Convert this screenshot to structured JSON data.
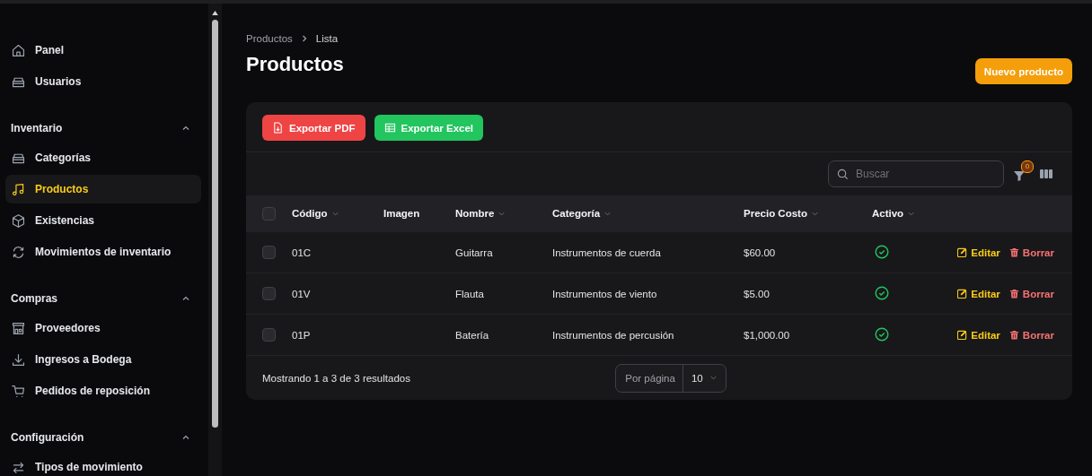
{
  "sidebar": {
    "items": [
      {
        "label": "Panel",
        "selected": false
      },
      {
        "label": "Usuarios",
        "selected": false
      }
    ],
    "groups": [
      {
        "label": "Inventario",
        "expanded": true,
        "items": [
          {
            "label": "Categorías",
            "selected": false
          },
          {
            "label": "Productos",
            "selected": true
          },
          {
            "label": "Existencias",
            "selected": false
          },
          {
            "label": "Movimientos de inventario",
            "selected": false
          }
        ]
      },
      {
        "label": "Compras",
        "expanded": true,
        "items": [
          {
            "label": "Proveedores",
            "selected": false
          },
          {
            "label": "Ingresos a Bodega",
            "selected": false
          },
          {
            "label": "Pedidos de reposición",
            "selected": false
          }
        ]
      },
      {
        "label": "Configuración",
        "expanded": true,
        "items": [
          {
            "label": "Tipos de movimiento",
            "selected": false
          }
        ]
      }
    ]
  },
  "breadcrumb": [
    "Productos",
    "Lista"
  ],
  "title": "Productos",
  "new_button": "Nuevo producto",
  "export_buttons": [
    {
      "kind": "pdf",
      "label": "Exportar PDF"
    },
    {
      "kind": "excel",
      "label": "Exportar Excel"
    }
  ],
  "search": {
    "placeholder": "Buscar"
  },
  "filter_count": "0",
  "table": {
    "select_all_checked": false,
    "columns": [
      {
        "label": "Código",
        "sortable": true
      },
      {
        "label": "Imagen",
        "sortable": false
      },
      {
        "label": "Nombre",
        "sortable": true
      },
      {
        "label": "Categoría",
        "sortable": true
      },
      {
        "label": "Precio Costo",
        "sortable": true
      },
      {
        "label": "Activo",
        "sortable": true
      }
    ],
    "rows": [
      {
        "checked": false,
        "code": "01C",
        "name": "Guitarra",
        "category": "Instrumentos de cuerda",
        "cost": "$60.00",
        "active": true,
        "edit": "Editar",
        "delete": "Borrar"
      },
      {
        "checked": false,
        "code": "01V",
        "name": "Flauta",
        "category": "Instrumentos de viento",
        "cost": "$5.00",
        "active": true,
        "edit": "Editar",
        "delete": "Borrar"
      },
      {
        "checked": false,
        "code": "01P",
        "name": "Batería",
        "category": "Instrumentos de percusión",
        "cost": "$1,000.00",
        "active": true,
        "edit": "Editar",
        "delete": "Borrar"
      }
    ]
  },
  "footer": {
    "summary": "Mostrando 1 a 3 de 3 resultados",
    "per_page_label": "Por página",
    "per_page_value": "10"
  }
}
